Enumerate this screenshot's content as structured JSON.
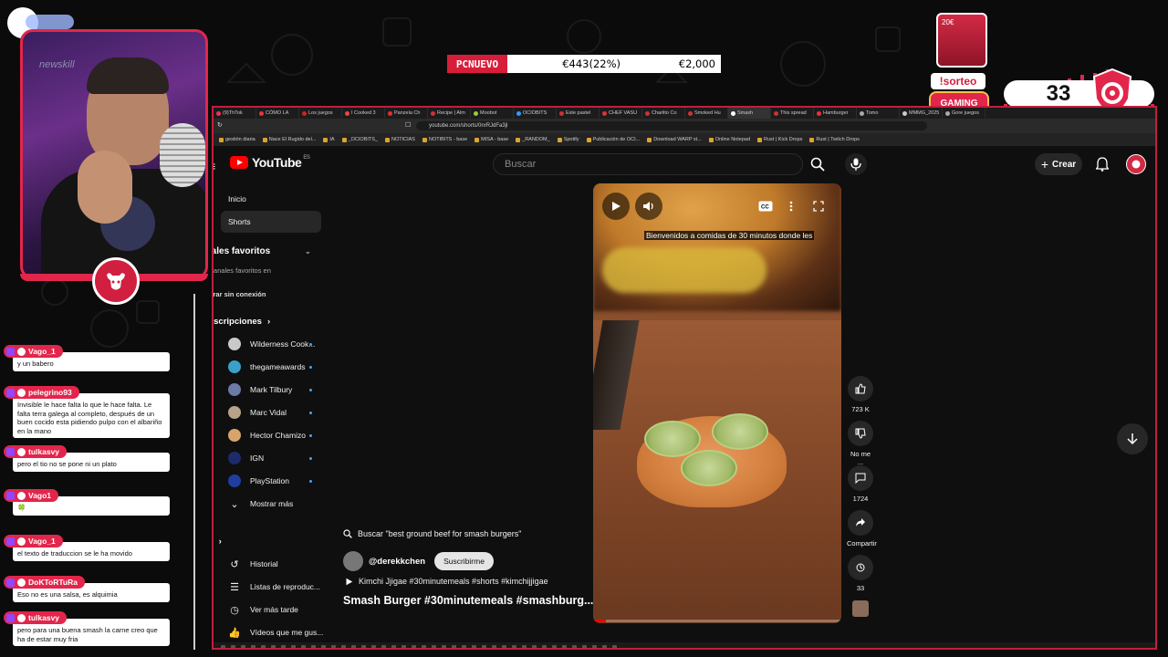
{
  "overlay": {
    "price_tag": "PCNUEVO",
    "price_value": "€443(22%)",
    "price_total": "€2,000",
    "sorteo": "!sorteo",
    "gaming_label": "GAMING",
    "counter": "33",
    "promo_label": "20€",
    "accent_color": "#e2264b"
  },
  "browser": {
    "tabs": [
      "(9)ThTok",
      "CÓMO LA",
      "Los juegos",
      "I Cooked 3",
      "Panzela Ch",
      "Recipe | Alm",
      "Moobot",
      "OCIOBITS",
      "Este pastel",
      "CHEF VASU",
      "Charlito Co",
      "Smoked Hu",
      "Smash",
      "This spread",
      "Hamburger",
      "Tomo",
      "MMMG_2025",
      "Gore juegos"
    ],
    "active_tab_index": 12,
    "url": "youtube.com/shorts/0nrRJdFa3jl",
    "bookmarks": [
      "gestión diaria",
      "Nace El Rugido del...",
      "IA",
      "_OCIOBITS_",
      "NOTICIAS",
      "NOTIBITS - base",
      "MISA - base",
      "_RANDOM_",
      "Spotify",
      "Publicación de OCI...",
      "Download WARP st...",
      "Online Notepad",
      "Rust | Kick Drops",
      "Rust | Twitch Drops"
    ]
  },
  "youtube": {
    "logo_text": "YouTube",
    "region": "ES",
    "search_placeholder": "Buscar",
    "create_label": "Crear",
    "sidebar": {
      "home": "Inicio",
      "shorts": "Shorts",
      "fav_head": "anales favoritos",
      "fav_note": "hay canales favoritos en",
      "offline": "Mostrar sin conexión",
      "subs_head": "Suscripciones",
      "channels": [
        {
          "name": "Wilderness Cook...",
          "color": "#c9c9c9"
        },
        {
          "name": "thegameawards",
          "color": "#3aa0c8"
        },
        {
          "name": "Mark Tilbury",
          "color": "#6b7aa6"
        },
        {
          "name": "Marc Vidal",
          "color": "#b7a28a"
        },
        {
          "name": "Hector Chamizo",
          "color": "#d7a46b"
        },
        {
          "name": "IGN",
          "color": "#1d2b6b"
        },
        {
          "name": "PlayStation",
          "color": "#1e3fa0"
        }
      ],
      "more": "Mostrar más",
      "you_head": "Tú",
      "history": "Historial",
      "playlists": "Listas de reproduc...",
      "watch_later": "Ver más tarde",
      "liked": "Vídeos que me gus..."
    },
    "video": {
      "caption": "Bienvenidos a comidas de 30 minutos donde les",
      "search_suggestion": "Buscar \"best ground beef for smash burgers\"",
      "channel": "@derekkchen",
      "subscribe": "Suscribirme",
      "music": "Kimchi Jjigae #30minutemeals #shorts #kimchijjigae",
      "title": "Smash Burger #30minutemeals #smashburg...",
      "progress": 0.05
    },
    "actions": {
      "likes": "723 K",
      "dislike": "No me ...",
      "comments": "1724",
      "share": "Compartir",
      "remix": "33"
    }
  },
  "chat": [
    {
      "user": "Vago_1",
      "text": "y un babero"
    },
    {
      "user": "pelegrino93",
      "text": "Invisible le hace falta lo que le hace falta. Le falta terra galega al completo, después de un buen cocido esta pidiendo pulpo con el albariño en la mano"
    },
    {
      "user": "tulkasvy",
      "text": "pero el tio no se pone ni un plato"
    },
    {
      "user": "Vago1",
      "text": "🍀"
    },
    {
      "user": "Vago_1",
      "text": "el texto de traduccion se le ha movido"
    },
    {
      "user": "DoKToRTuRa",
      "text": "Eso no es una salsa, es alquimia"
    },
    {
      "user": "tulkasvy",
      "text": "pero para una buena smash la carne creo que ha de estar muy fria"
    }
  ]
}
